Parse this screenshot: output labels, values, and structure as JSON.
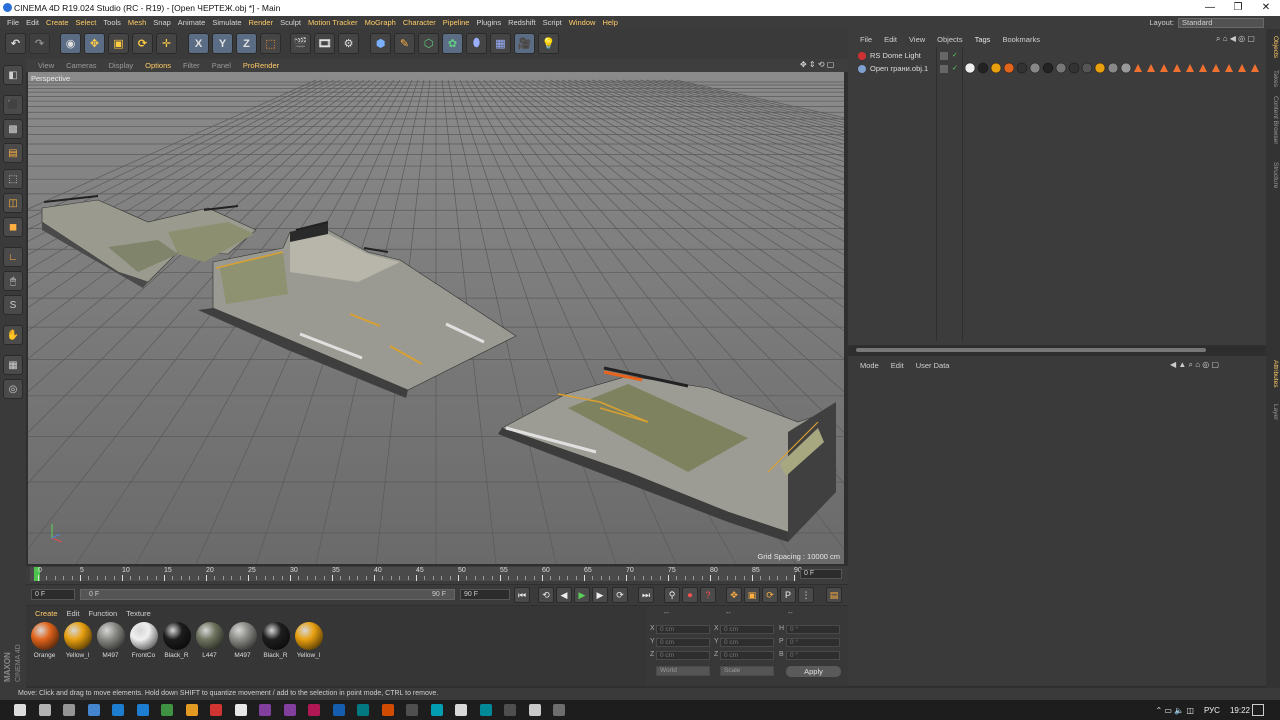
{
  "window": {
    "title": "CINEMA 4D R19.024 Studio (RC - R19) - [Open ЧЕРТЕЖ.obj *] - Main",
    "minimize": "—",
    "restore": "❐",
    "close": "✕"
  },
  "menu": [
    "File",
    "Edit",
    "Create",
    "Select",
    "Tools",
    "Mesh",
    "Snap",
    "Animate",
    "Simulate",
    "Render",
    "Sculpt",
    "Motion Tracker",
    "MoGraph",
    "Character",
    "Pipeline",
    "Plugins",
    "Redshift",
    "Script",
    "Window",
    "Help"
  ],
  "menu_highlight": [
    "Create",
    "Select",
    "Mesh",
    "Render",
    "Motion Tracker",
    "MoGraph",
    "Character",
    "Pipeline",
    "Window",
    "Help"
  ],
  "layout": {
    "label": "Layout:",
    "value": "Standard"
  },
  "viewport_menu": [
    "View",
    "Cameras",
    "Display",
    "Options",
    "Filter",
    "Panel",
    "ProRender"
  ],
  "viewport_menu_active": [
    "Options",
    "ProRender"
  ],
  "viewport": {
    "label": "Perspective",
    "grid_spacing": "Grid Spacing : 10000 cm"
  },
  "timeline": {
    "ticks": [
      "0",
      "5",
      "10",
      "15",
      "20",
      "25",
      "30",
      "35",
      "40",
      "45",
      "50",
      "55",
      "60",
      "65",
      "70",
      "75",
      "80",
      "85",
      "90"
    ],
    "current_frame": "0 F",
    "start_field": "0 F",
    "min_field": "0 F",
    "max_field": "90 F",
    "end_field": "90 F"
  },
  "material_menu": [
    "Create",
    "Edit",
    "Function",
    "Texture"
  ],
  "materials": [
    {
      "name": "Orange",
      "color": "#e0641c"
    },
    {
      "name": "Yellow_l",
      "color": "#e8a010"
    },
    {
      "name": "M497",
      "color": "#8a8a86"
    },
    {
      "name": "FrontCo",
      "color": "#f0f0f0"
    },
    {
      "name": "Black_R",
      "color": "#1c1c1c"
    },
    {
      "name": "L447",
      "color": "#6f7560"
    },
    {
      "name": "M497",
      "color": "#8c8c88"
    },
    {
      "name": "Black_R",
      "color": "#1e1e1e"
    },
    {
      "name": "Yellow_l",
      "color": "#e8a010"
    }
  ],
  "coords": {
    "header": "--",
    "rows": [
      {
        "a": "X",
        "av": "0 cm",
        "b": "X",
        "bv": "0 cm",
        "c": "H",
        "cv": "0 °"
      },
      {
        "a": "Y",
        "av": "0 cm",
        "b": "Y",
        "bv": "0 cm",
        "c": "P",
        "cv": "0 °"
      },
      {
        "a": "Z",
        "av": "0 cm",
        "b": "Z",
        "bv": "0 cm",
        "c": "B",
        "cv": "0 °"
      }
    ],
    "world": "World",
    "scale": "Scale",
    "apply": "Apply"
  },
  "status": "Move: Click and drag to move elements. Hold down SHIFT to quantize movement / add to the selection in point mode, CTRL to remove.",
  "object_menu": [
    "File",
    "Edit",
    "View",
    "Objects",
    "Tags",
    "Bookmarks"
  ],
  "objects": [
    {
      "name": "RS Dome Light",
      "icon_color": "#d03030"
    },
    {
      "name": "Open грани.obj.1",
      "icon_color": "#7fa0d0"
    }
  ],
  "attr_menu": [
    "Mode",
    "Edit",
    "User Data"
  ],
  "right_tabs": [
    "Objects",
    "Takes",
    "Content Browser",
    "Structure",
    "Attributes",
    "Layer"
  ],
  "tray": {
    "lang": "РУС",
    "time": "19:22"
  },
  "colors": {
    "accent": "#ffcc66",
    "panel": "#3a3a3a",
    "viewport": "#7e7e7e"
  }
}
